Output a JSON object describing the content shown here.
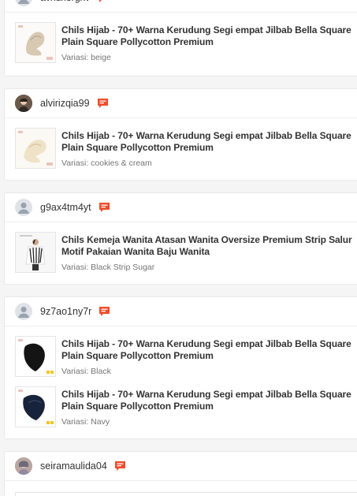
{
  "orders": [
    {
      "username": "avxdxergxv",
      "items": [
        {
          "title": "Chils Hijab - 70+ Warna Kerudung Segi empat Jilbab Bella Square Plain Square Pollycotton Premium",
          "variant": "Variasi: beige"
        }
      ]
    },
    {
      "username": "alvirizqia99",
      "items": [
        {
          "title": "Chils Hijab - 70+ Warna Kerudung Segi empat Jilbab Bella Square Plain Square Pollycotton Premium",
          "variant": "Variasi: cookies & cream"
        }
      ]
    },
    {
      "username": "g9ax4tm4yt",
      "items": [
        {
          "title": "Chils Kemeja Wanita Atasan Wanita Oversize Premium Strip Salur Motif Pakaian Wanita Baju Wanita",
          "variant": "Variasi: Black Strip Sugar"
        }
      ]
    },
    {
      "username": "9z7ao1ny7r",
      "items": [
        {
          "title": "Chils Hijab - 70+ Warna Kerudung Segi empat Jilbab Bella Square Plain Square Pollycotton Premium",
          "variant": "Variasi: Black"
        },
        {
          "title": "Chils Hijab - 70+ Warna Kerudung Segi empat Jilbab Bella Square Plain Square Pollycotton Premium",
          "variant": "Variasi: Navy"
        }
      ]
    },
    {
      "username": "seiramaulida04",
      "items": []
    }
  ],
  "colors": {
    "chat_accent": "#ee4d2d",
    "muted_text": "#757575"
  },
  "icons": {
    "chat": "chat-bubble-icon",
    "default_avatar": "user-silhouette-icon"
  }
}
